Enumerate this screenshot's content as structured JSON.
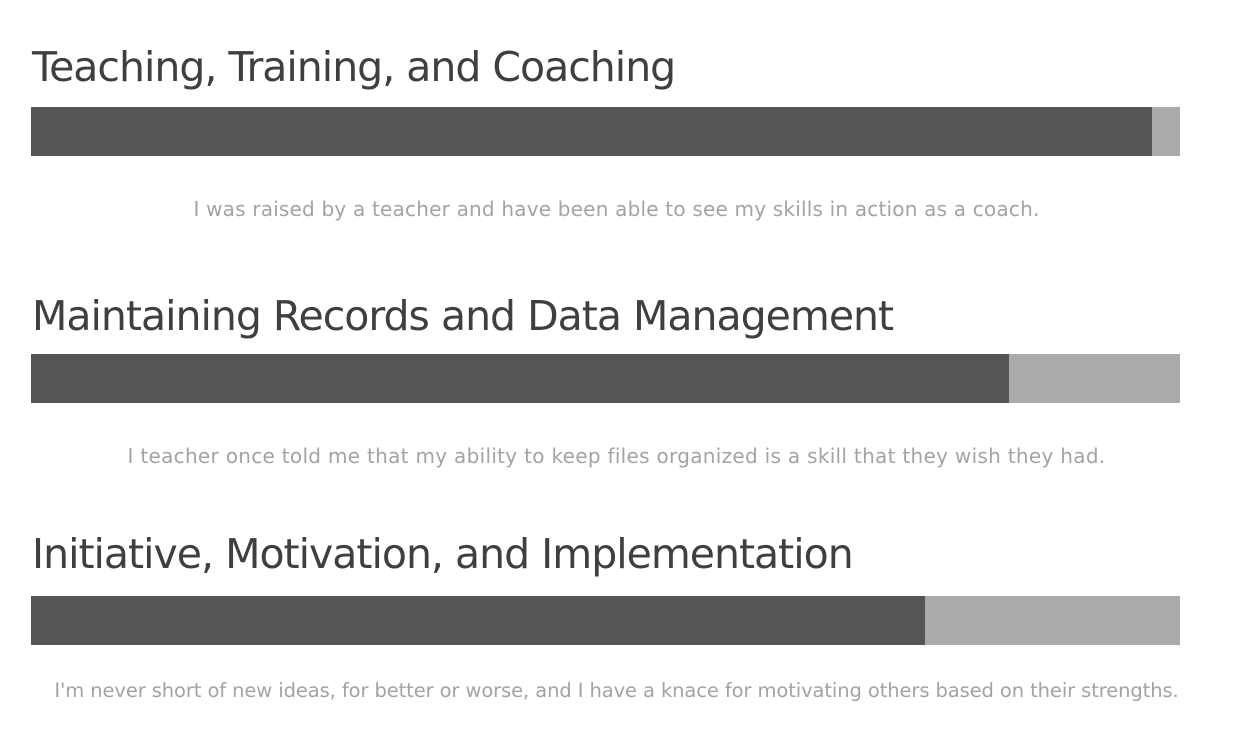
{
  "colors": {
    "bar_filled": "#555555",
    "bar_remaining": "#aaaaaa",
    "title_text": "#3f3f3f",
    "description_text": "#a3a3a3"
  },
  "skills": [
    {
      "title": "Teaching, Training, and Coaching",
      "level": 0.976,
      "description": "I was raised by a teacher and have been able to see my skills in action as a coach."
    },
    {
      "title": "Maintaining Records and Data Management",
      "level": 0.851,
      "description": "I teacher once told me that my ability to keep files organized is a skill that they wish they had."
    },
    {
      "title": "Initiative, Motivation, and Implementation",
      "level": 0.778,
      "description": "I'm never short of new ideas, for better or worse, and I have a knace for motivating others based on their strengths."
    }
  ]
}
